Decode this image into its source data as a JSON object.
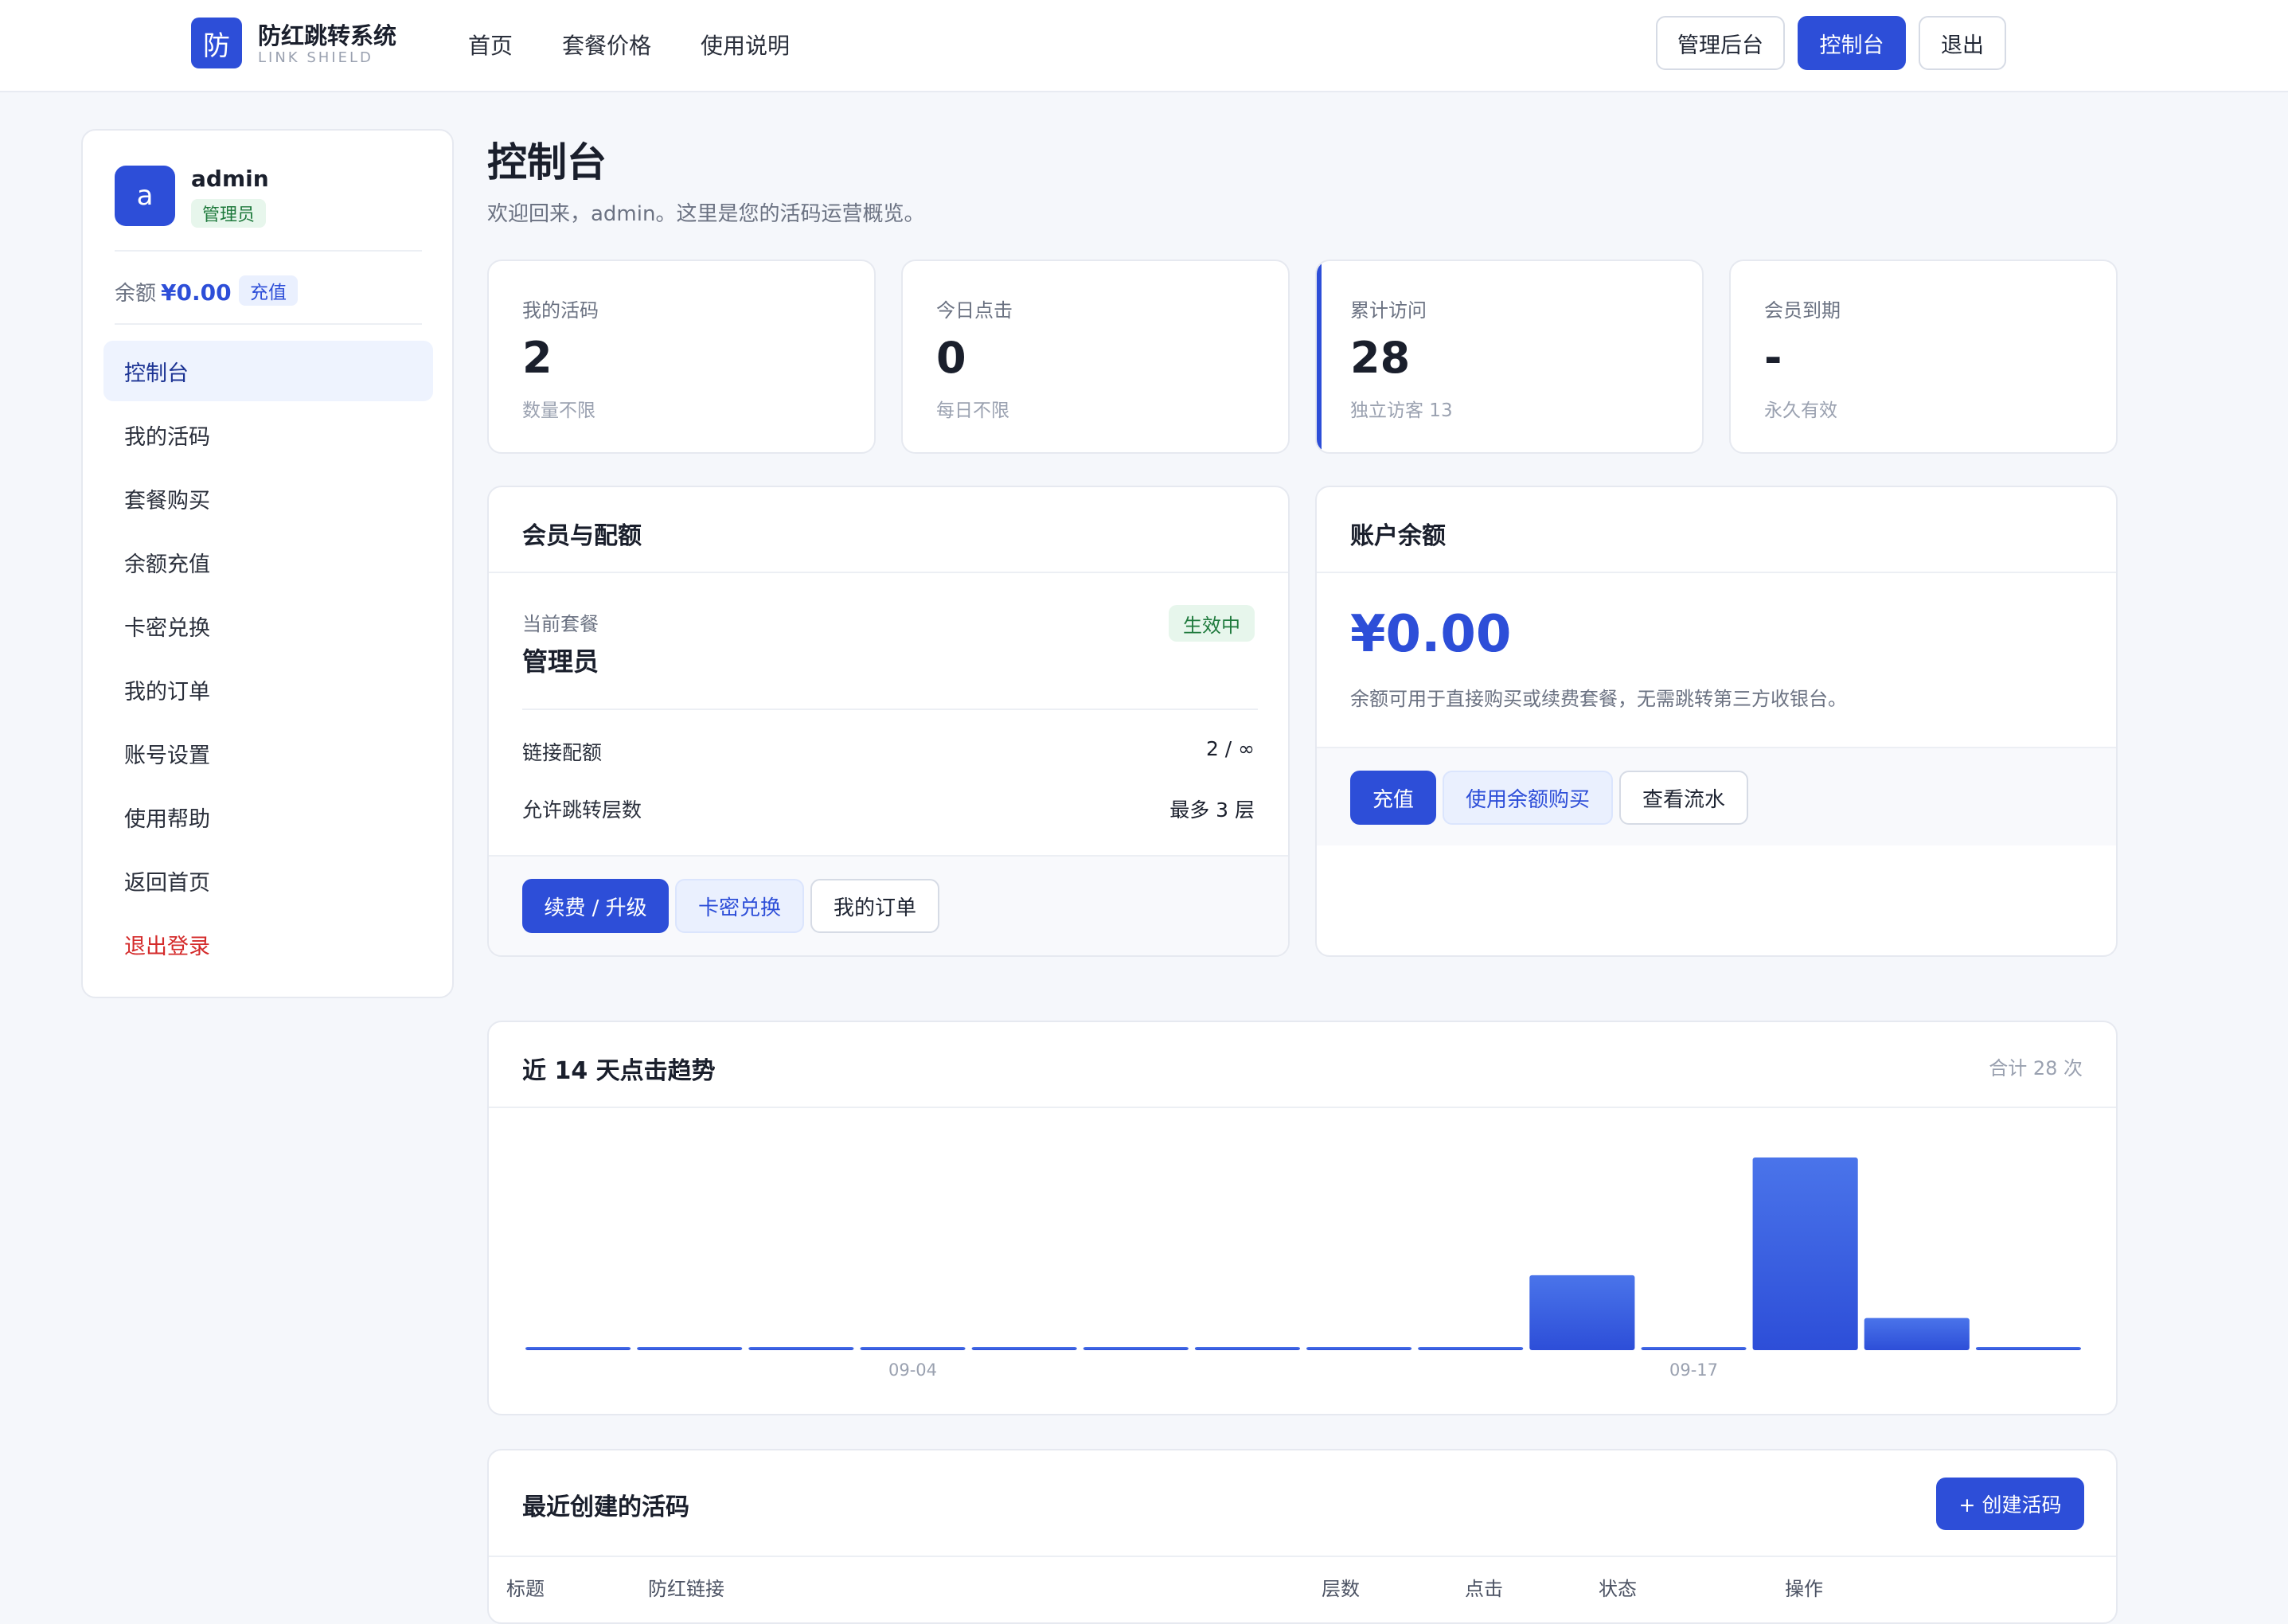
{
  "header": {
    "logo_char": "防",
    "brand_name": "防红跳转系统",
    "brand_sub": "LINK SHIELD",
    "nav": [
      "首页",
      "套餐价格",
      "使用说明"
    ],
    "admin_label": "管理后台",
    "console_label": "控制台",
    "logout_label": "退出"
  },
  "sidebar": {
    "avatar_char": "a",
    "username": "admin",
    "role": "管理员",
    "balance_label": "余额",
    "balance_value": "¥0.00",
    "recharge_label": "充值",
    "menu": [
      {
        "label": "控制台",
        "active": true
      },
      {
        "label": "我的活码"
      },
      {
        "label": "套餐购买"
      },
      {
        "label": "余额充值"
      },
      {
        "label": "卡密兑换"
      },
      {
        "label": "我的订单"
      },
      {
        "label": "账号设置"
      },
      {
        "label": "使用帮助"
      },
      {
        "label": "返回首页"
      },
      {
        "label": "退出登录",
        "danger": true
      }
    ]
  },
  "main": {
    "title": "控制台",
    "subtitle": "欢迎回来，admin。这里是您的活码运营概览。",
    "stats": [
      {
        "label": "我的活码",
        "value": "2",
        "note": "数量不限"
      },
      {
        "label": "今日点击",
        "value": "0",
        "note": "每日不限"
      },
      {
        "label": "累计访问",
        "value": "28",
        "note": "独立访客 13"
      },
      {
        "label": "会员到期",
        "value": "-",
        "note": "永久有效"
      }
    ],
    "membership": {
      "title": "会员与配额",
      "plan_label": "当前套餐",
      "plan_name": "管理员",
      "status": "生效中",
      "quota_label": "链接配额",
      "quota_value": "2 / ∞",
      "layers_label": "允许跳转层数",
      "layers_value": "最多 3 层",
      "btn_renew": "续费 / 升级",
      "btn_redeem": "卡密兑换",
      "btn_orders": "我的订单"
    },
    "balance": {
      "title": "账户余额",
      "amount": "¥0.00",
      "desc": "余额可用于直接购买或续费套餐，无需跳转第三方收银台。",
      "btn_recharge": "充值",
      "btn_buy": "使用余额购买",
      "btn_flow": "查看流水"
    },
    "trend": {
      "title": "近 14 天点击趋势",
      "total": "合计 28 次"
    },
    "recent": {
      "title": "最近创建的活码",
      "create_label": "+ 创建活码",
      "columns": [
        "标题",
        "防红链接",
        "层数",
        "点击",
        "状态",
        "操作"
      ]
    }
  },
  "colors": {
    "accent": "#2d4ed8",
    "success_bg": "#e7f6ec",
    "success_text": "#1f7a3d",
    "danger": "#d42b2b"
  },
  "chart_data": {
    "type": "bar",
    "categories": [
      "",
      "",
      "",
      "09-04",
      "",
      "",
      "",
      "",
      "",
      "",
      "09-17",
      "",
      "",
      ""
    ],
    "values": [
      0,
      0,
      0,
      0,
      0,
      0,
      0,
      0,
      0,
      7,
      0,
      18,
      3,
      0
    ],
    "ylim": [
      0,
      18
    ],
    "grid": false
  }
}
